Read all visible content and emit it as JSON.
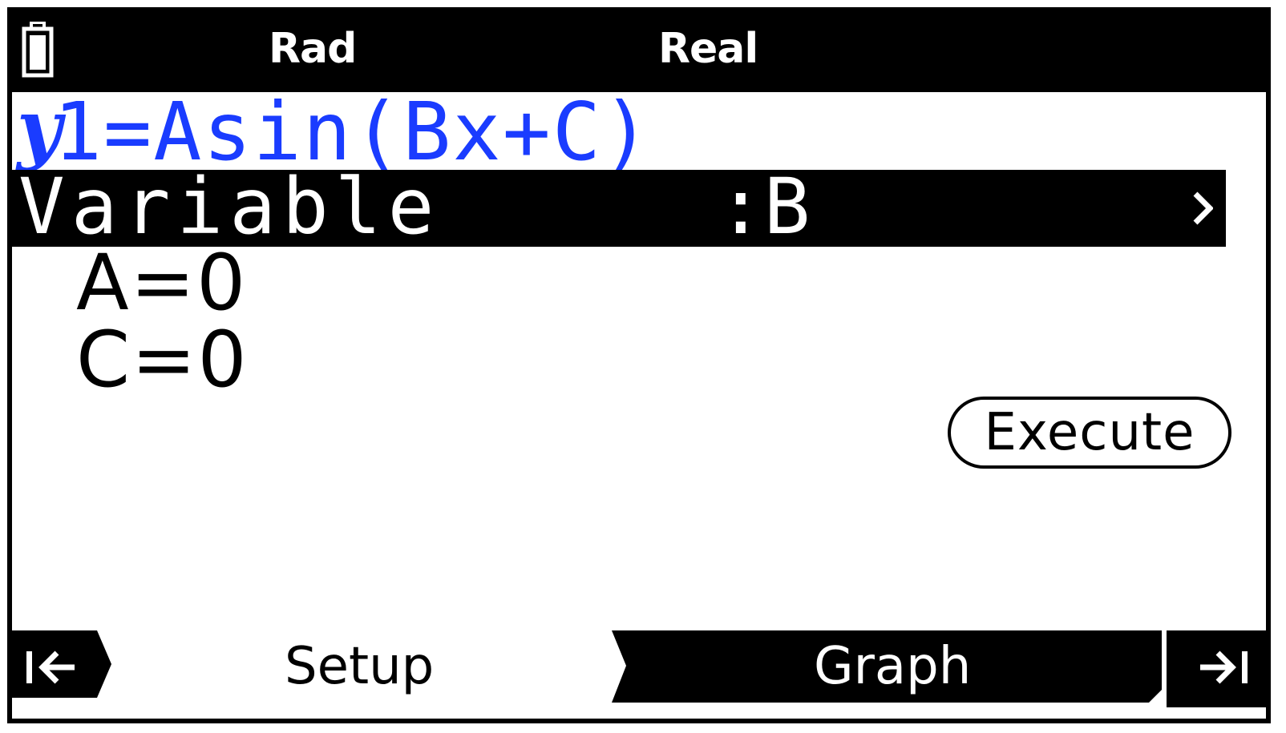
{
  "status_bar": {
    "angle_unit": "Rad",
    "number_mode": "Real"
  },
  "equation": {
    "function_symbol": "y",
    "expression": "1=Asin(Bx+C)"
  },
  "variable_row": {
    "label": "Variable",
    "value": ":B"
  },
  "values": [
    {
      "text": "A=0"
    },
    {
      "text": "C=0"
    }
  ],
  "execute_label": "Execute",
  "function_bar": {
    "setup_label": "Setup",
    "graph_label": "Graph"
  },
  "colors": {
    "equation_blue": "#1a3cff",
    "background": "#ffffff",
    "foreground": "#000000"
  },
  "icons": [
    "battery-icon",
    "chevron-right-icon",
    "back-to-start-icon",
    "to-end-icon"
  ]
}
